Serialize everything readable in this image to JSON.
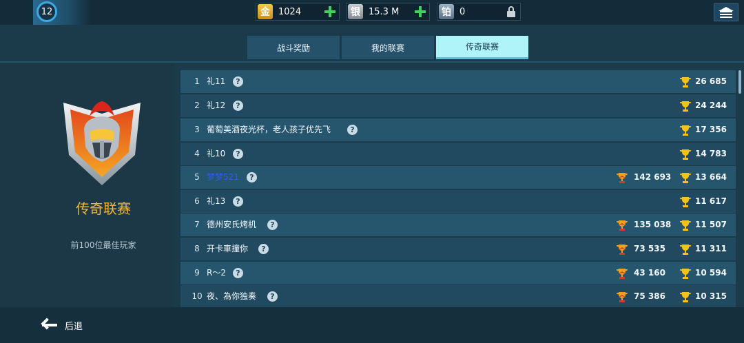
{
  "header": {
    "level": "12",
    "currencies": [
      {
        "icon_label": "金",
        "value": "1024",
        "action": "plus-icon"
      },
      {
        "icon_label": "银",
        "value": "15.3 M",
        "action": "plus-icon"
      },
      {
        "icon_label": "铂",
        "value": "0",
        "action": "lock-icon"
      }
    ]
  },
  "tabs": [
    {
      "label": "战斗奖励",
      "active": false
    },
    {
      "label": "我的联赛",
      "active": false
    },
    {
      "label": "传奇联赛",
      "active": true
    }
  ],
  "league": {
    "title": "传奇联赛",
    "subtitle": "前100位最佳玩家"
  },
  "ranking": {
    "rows": [
      {
        "rank": "1",
        "name": "礼11",
        "season_score": "",
        "score": "26 685"
      },
      {
        "rank": "2",
        "name": "礼12",
        "season_score": "",
        "score": "24 244"
      },
      {
        "rank": "3",
        "name": "葡萄美酒夜光杯，老人孩子优先飞",
        "season_score": "",
        "score": "17 356"
      },
      {
        "rank": "4",
        "name": "礼10",
        "season_score": "",
        "score": "14 783"
      },
      {
        "rank": "5",
        "name": "梦梦521",
        "season_score": "142 693",
        "score": "13 664"
      },
      {
        "rank": "6",
        "name": "礼13",
        "season_score": "",
        "score": "11 617"
      },
      {
        "rank": "7",
        "name": "德州安氏烤机",
        "season_score": "135 038",
        "score": "11 507"
      },
      {
        "rank": "8",
        "name": "开卡車撞你",
        "season_score": "73 535",
        "score": "11 311"
      },
      {
        "rank": "9",
        "name": "R〜2",
        "season_score": "43 160",
        "score": "10 594"
      },
      {
        "rank": "10",
        "name": "夜、為你独奏",
        "season_score": "75 386",
        "score": "10 315"
      }
    ]
  },
  "footer": {
    "back_label": "后退"
  },
  "colors": {
    "background": "#1b3a4a",
    "active_tab": "#aef4f8",
    "league_title": "#f2b63a",
    "trophy_gold": "#f5c21b",
    "trophy_red": "#d43a2a",
    "plus_green": "#3ed45c",
    "highlight_name": "#2f5de8"
  }
}
